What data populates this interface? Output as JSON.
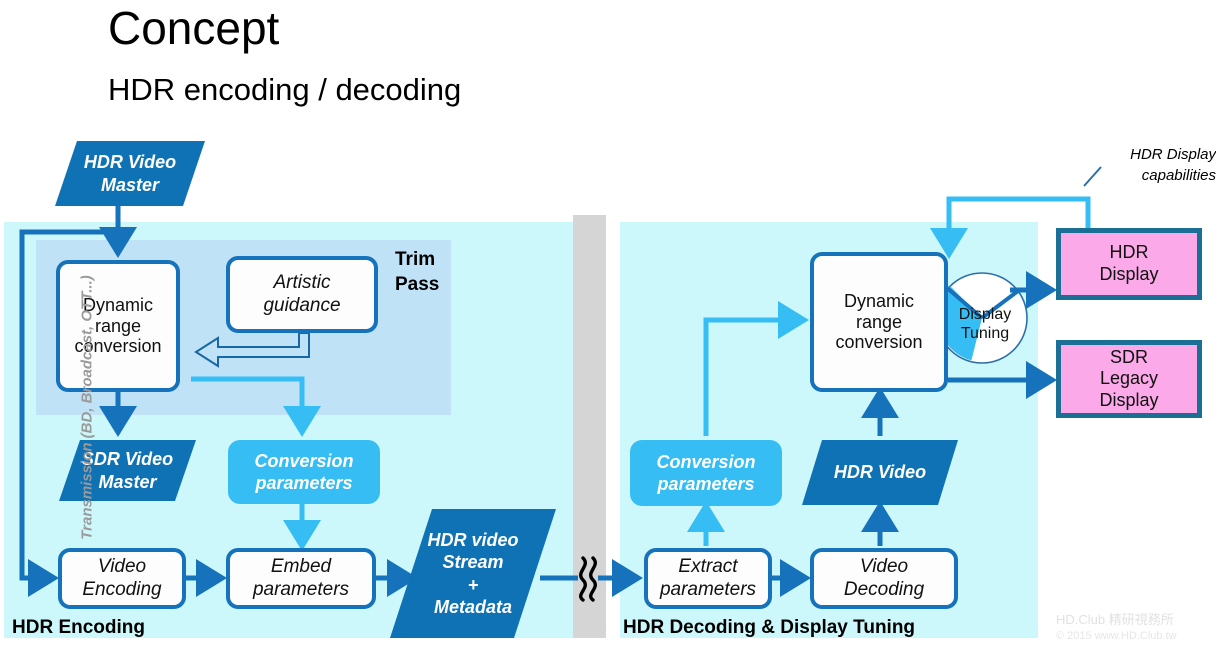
{
  "heading": {
    "title": "Concept",
    "subtitle": "HDR encoding / decoding"
  },
  "colors": {
    "deep_blue": "#1572bb",
    "data_blue": "#0f72b5",
    "light_blue": "#35bdf4",
    "panel_bg": "#ccf8fc",
    "trim_bg": "#bfe2f7",
    "pink": "#fba9e8",
    "pink_border": "#1b6f94",
    "transmission_bg": "#d5d5d5",
    "transmission_text": "#9a9a9a",
    "watermark": "#e2e2e2"
  },
  "encoding_panel": {
    "caption": "HDR Encoding",
    "trim_pass_label": "Trim\nPass",
    "trim_pass_line1": "Trim",
    "trim_pass_line2": "Pass",
    "input": {
      "line1": "HDR Video",
      "line2": "Master"
    },
    "dynamic_range_conversion": {
      "line1": "Dynamic",
      "line2": "range",
      "line3": "conversion"
    },
    "artistic_guidance": {
      "line1": "Artistic",
      "line2": "guidance"
    },
    "sdr_master": {
      "line1": "SDR Video",
      "line2": "Master"
    },
    "conversion_parameters": {
      "line1": "Conversion",
      "line2": "parameters"
    },
    "video_encoding": {
      "line1": "Video",
      "line2": "Encoding"
    },
    "embed_parameters": {
      "line1": "Embed",
      "line2": "parameters"
    },
    "hdr_stream": {
      "line1": "HDR video",
      "line2": "Stream",
      "line3": "+",
      "line4": "Metadata"
    }
  },
  "transmission": {
    "label": "Transmission (BD, Broadcast, OTT...)"
  },
  "decoding_panel": {
    "caption": "HDR Decoding & Display Tuning",
    "extract_parameters": {
      "line1": "Extract",
      "line2": "parameters"
    },
    "video_decoding": {
      "line1": "Video",
      "line2": "Decoding"
    },
    "conversion_parameters": {
      "line1": "Conversion",
      "line2": "parameters"
    },
    "hdr_video": {
      "line1": "HDR Video"
    },
    "dynamic_range_conversion": {
      "line1": "Dynamic",
      "line2": "range",
      "line3": "conversion"
    },
    "display_tuning": {
      "line1": "Display",
      "line2": "Tuning"
    }
  },
  "displays": {
    "hdr": {
      "line1": "HDR",
      "line2": "Display"
    },
    "sdr": {
      "line1": "SDR",
      "line2": "Legacy",
      "line3": "Display"
    },
    "capabilities_callout": {
      "line1": "HDR Display",
      "line2": "capabilities"
    }
  },
  "watermark": {
    "line1": "HD.Club 精研視務所",
    "line2": "© 2015  www.HD.Club.tw"
  }
}
